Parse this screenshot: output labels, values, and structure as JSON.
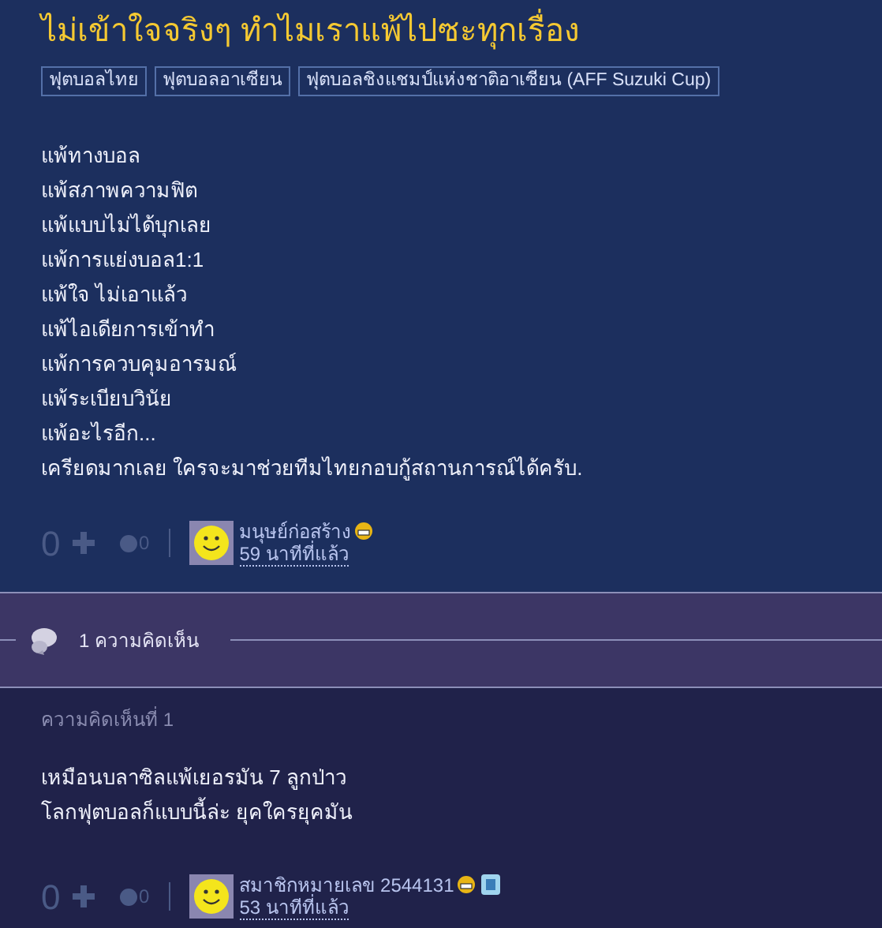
{
  "topic": {
    "title": "ไม่เข้าใจจริงๆ ทำไมเราแพ้ไปซะทุกเรื่อง",
    "tags": [
      "ฟุตบอลไทย",
      "ฟุตบอลอาเซียน",
      "ฟุตบอลชิงแชมป์แห่งชาติอาเซียน (AFF Suzuki Cup)"
    ],
    "body": [
      "แพ้ทางบอล",
      "แพ้สภาพความฟิต",
      "แพ้แบบไม่ได้บุกเลย",
      "แพ้การแย่งบอล1:1",
      "แพ้ใจ ไม่เอาแล้ว",
      "แพ้ไอเดียการเข้าทำ",
      "แพ้การควบคุมอารมณ์",
      "แพ้ระเบียบวินัย",
      "แพ้อะไรอีก...",
      "เครียดมากเลย ใครจะมาช่วยทีมไทยกอบกู้สถานการณ์ได้ครับ."
    ],
    "votes": "0",
    "emotions": "0",
    "author": "มนุษย์ก่อสร้าง",
    "badge": false,
    "time": "59 นาทีที่แล้ว"
  },
  "comments_bar": {
    "count": "1 ความคิดเห็น"
  },
  "comments": [
    {
      "label": "ความคิดเห็นที่ 1",
      "body": [
        "เหมือนบลาซิลแพ้เยอรมัน 7 ลูกป่าว",
        "โลกฟุตบอลก็แบบนี้ล่ะ ยุคใครยุคมัน"
      ],
      "votes": "0",
      "emotions": "0",
      "author": "สมาชิกหมายเลข 2544131",
      "badge": true,
      "time": "53 นาทีที่แล้ว"
    }
  ]
}
